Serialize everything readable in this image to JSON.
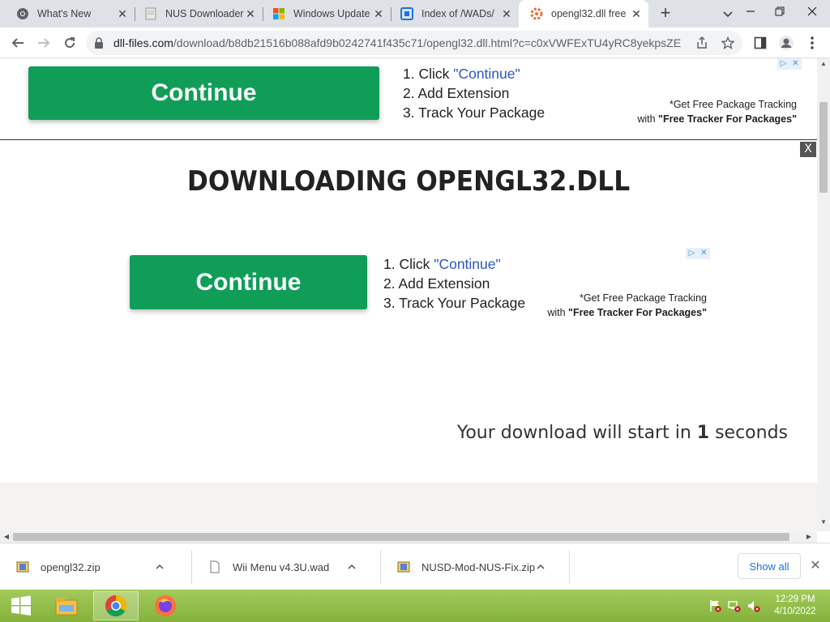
{
  "browser": {
    "tabs": [
      {
        "title": "What's New",
        "icon": "chrome-icon"
      },
      {
        "title": "NUS Downloader",
        "icon": "page-icon"
      },
      {
        "title": "Windows Update",
        "icon": "windows-logo-icon"
      },
      {
        "title": "Index of /WADs/",
        "icon": "index-icon"
      },
      {
        "title": "opengl32.dll free",
        "icon": "dll-files-icon",
        "active": true
      }
    ],
    "new_tab_label": "+",
    "url_host": "dll-files.com",
    "url_path": "/download/b8db21516b088afd9b0242741f435c71/opengl32.dll.html?c=c0xVWFExTU4yRC8yekpsZEl..."
  },
  "ad": {
    "button_label": "Continue",
    "step1_prefix": "1. Click ",
    "step1_quote": "\"Continue\"",
    "step2": "2. Add Extension",
    "step3": "3. Track Your Package",
    "tracker_line1": "*Get Free Package Tracking",
    "tracker_line2_prefix": "with ",
    "tracker_line2_bold": "\"Free Tracker For Packages\"",
    "close_label": "X"
  },
  "main": {
    "headline": "DOWNLOADING OPENGL32.DLL",
    "countdown_prefix": "Your download will start in ",
    "countdown_value": "1",
    "countdown_suffix": " seconds"
  },
  "downloads": {
    "items": [
      {
        "name": "opengl32.zip"
      },
      {
        "name": "Wii Menu v4.3U.wad"
      },
      {
        "name": "NUSD-Mod-NUS-Fix.zip"
      }
    ],
    "show_all_label": "Show all"
  },
  "taskbar": {
    "time": "12:29 PM",
    "date": "4/10/2022"
  },
  "colors": {
    "continue_green": "#0f9d58",
    "link_blue": "#2a56c6",
    "taskbar_green": "#95bf4b"
  }
}
